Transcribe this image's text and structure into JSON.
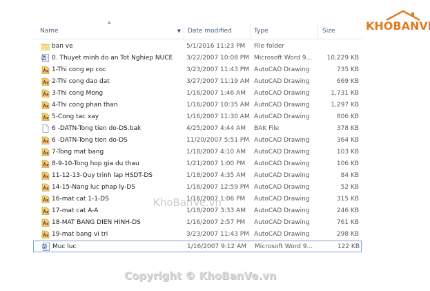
{
  "columns": {
    "name": "Name",
    "date": "Date modified",
    "type": "Type",
    "size": "Size"
  },
  "files": [
    {
      "icon": "folder-icon",
      "name": "ban ve",
      "date": "5/1/2016 11:23 PM",
      "type": "File folder",
      "size": ""
    },
    {
      "icon": "word-document-icon",
      "name": "0. Thuyet minh do an Tot Nghiep NUCE",
      "date": "3/22/2007 10:08 PM",
      "type": "Microsoft Word 9...",
      "size": "10,229 KB"
    },
    {
      "icon": "autocad-file-icon",
      "name": "1-Thi cong ep coc",
      "date": "3/23/2007 11:43 PM",
      "type": "AutoCAD Drawing",
      "size": "735 KB"
    },
    {
      "icon": "autocad-file-icon",
      "name": "2-Thi cong dao dat",
      "date": "3/27/2007 11:19 AM",
      "type": "AutoCAD Drawing",
      "size": "669 KB"
    },
    {
      "icon": "autocad-file-icon",
      "name": "3-Thi cong Mong",
      "date": "1/16/2007 1:46 AM",
      "type": "AutoCAD Drawing",
      "size": "1,731 KB"
    },
    {
      "icon": "autocad-file-icon",
      "name": "4-Thi cong phan than",
      "date": "1/16/2007 10:35 AM",
      "type": "AutoCAD Drawing",
      "size": "1,297 KB"
    },
    {
      "icon": "autocad-file-icon",
      "name": "5-Cong tac xay",
      "date": "1/16/2007 11:30 AM",
      "type": "AutoCAD Drawing",
      "size": "806 KB"
    },
    {
      "icon": "bak-file-icon",
      "name": "6 -DATN-Tong tien do-DS.bak",
      "date": "4/25/2007 4:44 AM",
      "type": "BAK File",
      "size": "378 KB"
    },
    {
      "icon": "autocad-file-icon",
      "name": "6 -DATN-Tong tien do-DS",
      "date": "11/20/2007 5:51 PM",
      "type": "AutoCAD Drawing",
      "size": "364 KB"
    },
    {
      "icon": "autocad-file-icon",
      "name": "7-Tong mat bang",
      "date": "1/18/2007 4:10 AM",
      "type": "AutoCAD Drawing",
      "size": "103 KB"
    },
    {
      "icon": "autocad-file-icon",
      "name": "8-9-10-Tong hop gia du thau",
      "date": "1/21/2007 1:00 PM",
      "type": "AutoCAD Drawing",
      "size": "106 KB"
    },
    {
      "icon": "autocad-file-icon",
      "name": "11-12-13-Quy trinh lap HSDT-DS",
      "date": "1/18/2007 4:35 AM",
      "type": "AutoCAD Drawing",
      "size": "84 KB"
    },
    {
      "icon": "autocad-file-icon",
      "name": "14-15-Nang luc phap ly-DS",
      "date": "1/16/2007 12:59 PM",
      "type": "AutoCAD Drawing",
      "size": "52 KB"
    },
    {
      "icon": "autocad-file-icon",
      "name": "16-mat cat 1-1-DS",
      "date": "1/16/2007 1:06 PM",
      "type": "AutoCAD Drawing",
      "size": "315 KB"
    },
    {
      "icon": "autocad-file-icon",
      "name": "17-mat cat A-A",
      "date": "1/18/2007 3:33 AM",
      "type": "AutoCAD Drawing",
      "size": "246 KB"
    },
    {
      "icon": "autocad-file-icon",
      "name": "18-MAT BANG DIEN HINH-DS",
      "date": "1/16/2007 2:57 PM",
      "type": "AutoCAD Drawing",
      "size": "761 KB"
    },
    {
      "icon": "autocad-file-icon",
      "name": "19-mat bang vi tri",
      "date": "3/23/2007 11:43 PM",
      "type": "AutoCAD Drawing",
      "size": "298 KB"
    },
    {
      "icon": "word-document-icon",
      "name": "Muc luc",
      "date": "1/16/2007 9:12 AM",
      "type": "Microsoft Word 9...",
      "size": "122 KB"
    }
  ],
  "logo": {
    "text": "KHOBANVE"
  },
  "watermark": {
    "text": "KhoBanVe.vn"
  },
  "copyright": {
    "text": "Copyright © KhoBanVe.vn"
  },
  "colors": {
    "accent": "#e07a1f",
    "header_text": "#4c607a",
    "selection_border": "#7da2ce"
  }
}
